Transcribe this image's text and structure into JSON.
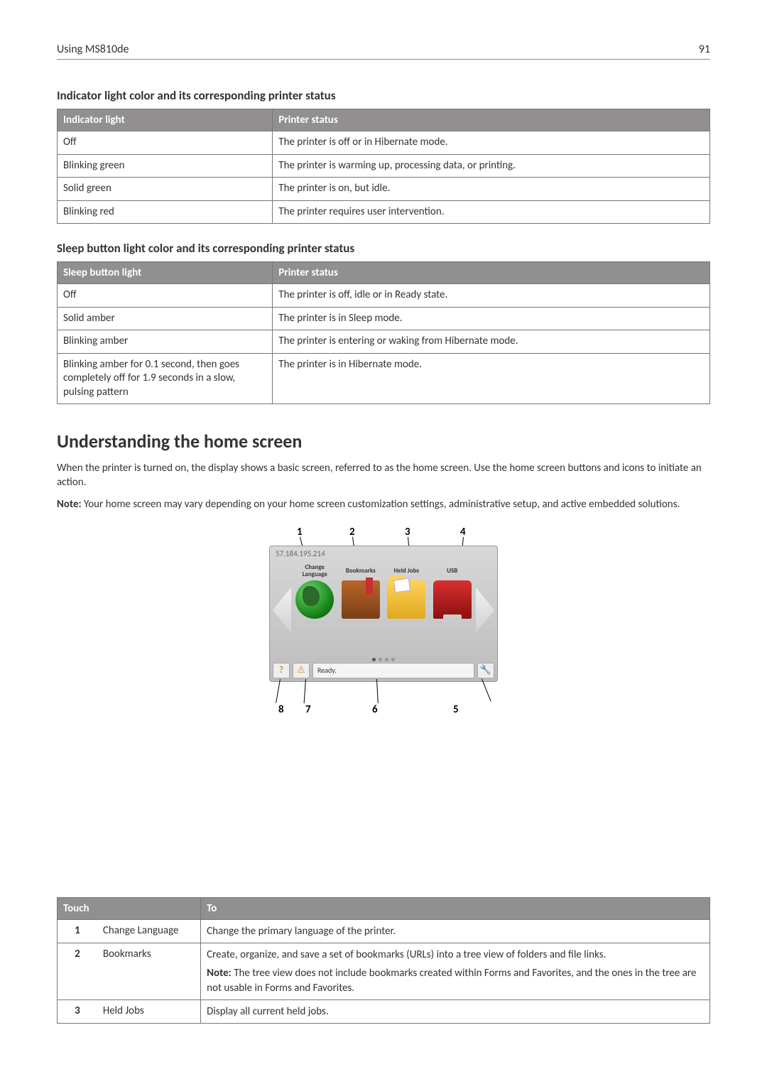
{
  "header": {
    "left": "Using MS810de",
    "right": "91"
  },
  "section1": {
    "title": "Indicator light color and its corresponding printer status",
    "headers": [
      "Indicator light",
      "Printer status"
    ],
    "rows": [
      [
        "Off",
        "The printer is off or in Hibernate mode."
      ],
      [
        "Blinking green",
        "The printer is warming up, processing data, or printing."
      ],
      [
        "Solid green",
        "The printer is on, but idle."
      ],
      [
        "Blinking red",
        "The printer requires user intervention."
      ]
    ]
  },
  "section2": {
    "title": "Sleep button light color and its corresponding printer status",
    "headers": [
      "Sleep button light",
      "Printer status"
    ],
    "rows": [
      [
        "Off",
        "The printer is off, idle or in Ready state."
      ],
      [
        "Solid amber",
        "The printer is in Sleep mode."
      ],
      [
        "Blinking amber",
        "The printer is entering or waking from Hibernate mode."
      ],
      [
        "Blinking amber for 0.1 second, then goes completely off for 1.9 seconds in a slow, pulsing pattern",
        "The printer is in Hibernate mode."
      ]
    ]
  },
  "understanding": {
    "title": "Understanding the home screen",
    "para1": "When the printer is turned on, the display shows a basic screen, referred to as the home screen. Use the home screen buttons and icons to initiate an action.",
    "note_label": "Note:",
    "note_body": " Your home screen may vary depending on your home screen customization settings, administrative setup, and active embedded solutions."
  },
  "homescreen": {
    "callouts_top": [
      "1",
      "2",
      "3",
      "4"
    ],
    "callouts_bottom": [
      "8",
      "7",
      "6",
      "5"
    ],
    "ip": "57.184.195.214",
    "icons": [
      {
        "label": "Change Language"
      },
      {
        "label": "Bookmarks"
      },
      {
        "label": "Held Jobs"
      },
      {
        "label": "USB"
      }
    ],
    "status": "Ready.",
    "help": "?",
    "warning": "⚠",
    "tools": "🔧"
  },
  "touch_table": {
    "headers": [
      "Touch",
      "To"
    ],
    "rows": [
      {
        "num": "1",
        "name": "Change Language",
        "paras": [
          "Change the primary language of the printer."
        ]
      },
      {
        "num": "2",
        "name": "Bookmarks",
        "paras": [
          "Create, organize, and save a set of bookmarks (URLs) into a tree view of folders and file links.",
          "<b>Note:</b> The tree view does not include bookmarks created within Forms and Favorites, and the ones in the tree are not usable in Forms and Favorites."
        ]
      },
      {
        "num": "3",
        "name": "Held Jobs",
        "paras": [
          "Display all current held jobs."
        ]
      }
    ]
  }
}
